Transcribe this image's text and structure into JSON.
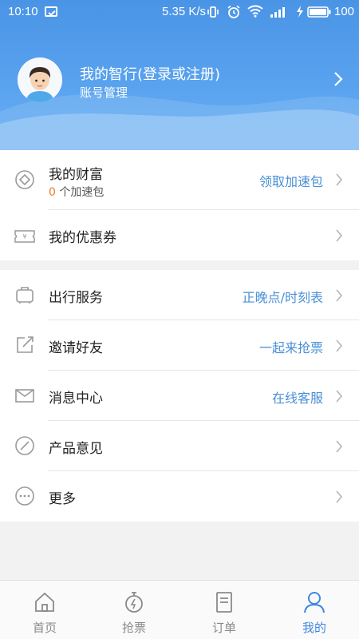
{
  "status_bar": {
    "time": "10:10",
    "speed": "5.35 K/s",
    "battery": "100",
    "icons": [
      "photo-icon",
      "vibrate-icon",
      "alarm-icon",
      "wifi-icon",
      "signal-icon",
      "charging-icon",
      "battery-icon"
    ]
  },
  "profile": {
    "name": "我的智行(登录或注册)",
    "subtitle": "账号管理"
  },
  "wealth": {
    "label": "我的财富",
    "count": "0",
    "count_suffix": " 个加速包",
    "action": "领取加速包"
  },
  "coupon": {
    "label": "我的优惠券"
  },
  "menu": [
    {
      "label": "出行服务",
      "right": "正晚点/时刻表",
      "icon": "luggage-icon"
    },
    {
      "label": "邀请好友",
      "right": "一起来抢票",
      "icon": "share-icon"
    },
    {
      "label": "消息中心",
      "right": "在线客服",
      "icon": "mail-icon"
    },
    {
      "label": "产品意见",
      "right": "",
      "icon": "feedback-pen-icon"
    },
    {
      "label": "更多",
      "right": "",
      "icon": "more-dots-icon"
    }
  ],
  "bottom_nav": [
    {
      "label": "首页",
      "icon": "home-icon"
    },
    {
      "label": "抢票",
      "icon": "stopwatch-icon"
    },
    {
      "label": "订单",
      "icon": "order-icon"
    },
    {
      "label": "我的",
      "icon": "person-icon",
      "active": true
    }
  ],
  "colors": {
    "header_blue": "#5aa3ef",
    "accent_link": "#4a8fd6",
    "highlight_orange": "#f07a27",
    "nav_active": "#3f87dd"
  }
}
